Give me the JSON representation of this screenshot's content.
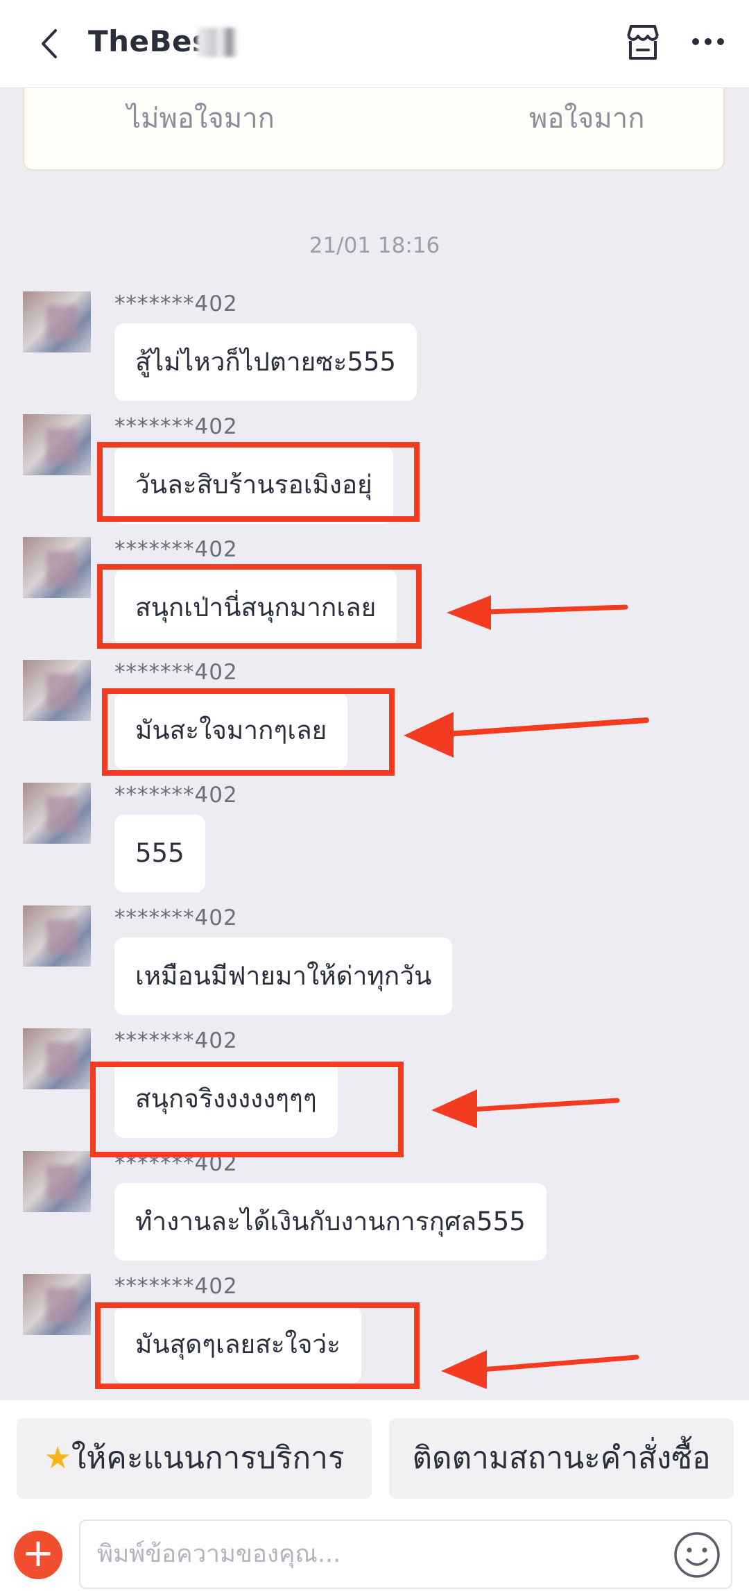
{
  "header": {
    "title": "TheBest",
    "icons": [
      "back-icon",
      "store-icon",
      "more-icon"
    ]
  },
  "rating_card": {
    "low_label": "ไม่พอใจมาก",
    "high_label": "พอใจมาก"
  },
  "timestamp": "21/01 18:16",
  "messages": [
    {
      "sender": "*******402",
      "text": "สู้ไม่ไหวก็ไปตายซะ555",
      "highlighted": false
    },
    {
      "sender": "*******402",
      "text": "วันละสิบร้านรอเมิงอยุ่",
      "highlighted": true
    },
    {
      "sender": "*******402",
      "text": "สนุกเป่านี่สนุกมากเลย",
      "highlighted": true
    },
    {
      "sender": "*******402",
      "text": "มันสะใจมากๆเลย",
      "highlighted": true
    },
    {
      "sender": "*******402",
      "text": "555",
      "highlighted": false
    },
    {
      "sender": "*******402",
      "text": "เหมือนมีฟายมาให้ด่าทุกวัน",
      "highlighted": false
    },
    {
      "sender": "*******402",
      "text": "สนุกจริงงงงงๆๆๆ",
      "highlighted": true
    },
    {
      "sender": "*******402",
      "text": "ทำงานละได้เงินกับงานการกุศล555",
      "highlighted": false
    },
    {
      "sender": "*******402",
      "text": "มันสุดๆเลยสะใจว่ะ",
      "highlighted": true
    }
  ],
  "quick_actions": {
    "rate_service": "ให้คะแนนการบริการ",
    "rate_icon": "star-icon",
    "track_order": "ติดตามสถานะคำสั่งซื้อ"
  },
  "input": {
    "placeholder": "พิมพ์ข้อความของคุณ..."
  },
  "colors": {
    "background": "#ececf2",
    "highlight": "#f23b1f",
    "accent": "#f04e2f"
  }
}
